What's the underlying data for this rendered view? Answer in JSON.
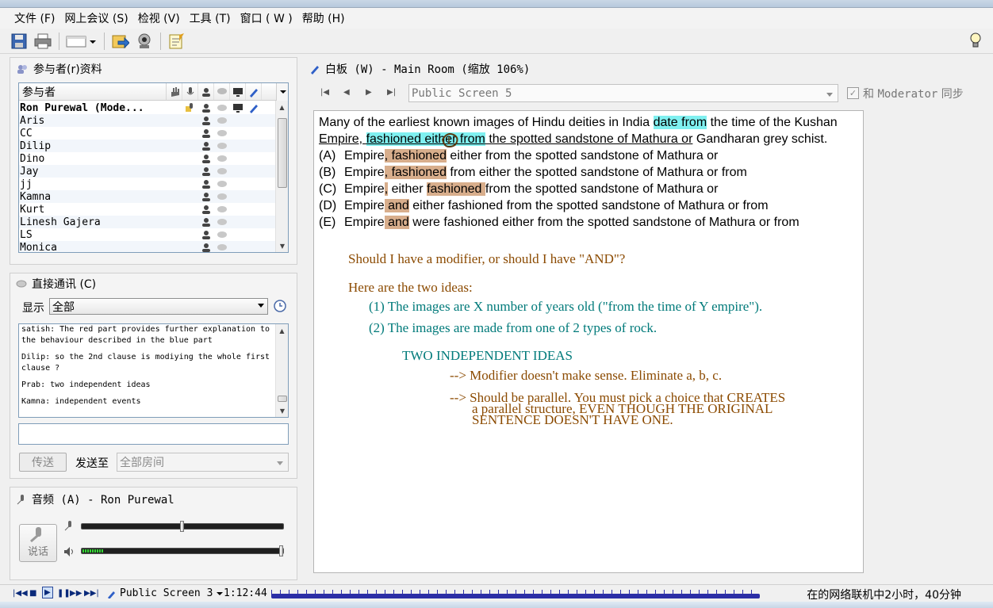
{
  "menu": [
    {
      "label": "文件 (F)"
    },
    {
      "label": "网上会议 (S)"
    },
    {
      "label": "检视 (V)"
    },
    {
      "label": "工具 (T)"
    },
    {
      "label": "窗口 ( W )"
    },
    {
      "label": "帮助 (H)"
    }
  ],
  "participants": {
    "title": "参与者(r)资料",
    "column_header": "参与者",
    "rows": [
      {
        "name": "Ron Purewal (Mode..."
      },
      {
        "name": "Aris"
      },
      {
        "name": "CC"
      },
      {
        "name": "Dilip"
      },
      {
        "name": "Dino"
      },
      {
        "name": "Jay"
      },
      {
        "name": "jj"
      },
      {
        "name": "Kamna"
      },
      {
        "name": "Kurt"
      },
      {
        "name": "Linesh Gajera"
      },
      {
        "name": "LS"
      },
      {
        "name": "Monica"
      }
    ]
  },
  "chat": {
    "title": "直接通讯 (C)",
    "filter_label": "显示",
    "filter_value": "全部",
    "messages": [
      {
        "text": "satish: The red part provides further explanation to the behaviour described in the blue part"
      },
      {
        "text": "Dilip: so the 2nd clause is modiying the whole first clause ?"
      },
      {
        "text": "Prab: two independent ideas"
      },
      {
        "text": "Kamna: independent events"
      }
    ],
    "send_label": "传送",
    "send_to_label": "发送至",
    "send_to_value": "全部房间"
  },
  "audio": {
    "title": "音频 (A) - Ron Purewal",
    "talk_label": "说话",
    "mic_level": 0.5,
    "speaker_level": 1.0
  },
  "whiteboard": {
    "title": "白板 (W) - Main Room (缩放 106%)",
    "screen_select": "Public Screen 5",
    "sync_label_prefix": "和",
    "sync_label_name": "Moderator",
    "sync_label_suffix": "同步",
    "question": {
      "s1": "Many of the earliest known images of Hindu deities in India ",
      "s2": "date from",
      "s3": " the time of the Kushan",
      "s4": "Empire, ",
      "s5": "fashioned either from",
      "s6": " the spotted sandstone of Mathura or",
      "s7": " Gandharan grey schist."
    },
    "choices": [
      {
        "label": "(A)",
        "pre": "Empire",
        "hl": ", fashioned",
        "post": " either from the spotted sandstone of Mathura or"
      },
      {
        "label": "(B)",
        "pre": "Empire",
        "hl": ", fashioned",
        "post": " from either the spotted sandstone of Mathura or from"
      },
      {
        "label": "(C)",
        "pre": "Empire",
        "hl": ",",
        "mid": " either ",
        "hl2": "fashioned ",
        "post": "from the spotted sandstone of Mathura or"
      },
      {
        "label": "(D)",
        "pre": "Empire",
        "hl": " and",
        "post": " either fashioned from the spotted sandstone of Mathura or from"
      },
      {
        "label": "(E)",
        "pre": "Empire",
        "hl": " and",
        "post": " were fashioned either from the spotted sandstone of Mathura or from"
      }
    ],
    "notes": {
      "n1": "Should I have a modifier, or should I have \"AND\"?",
      "n2": "Here are the two ideas:",
      "n3": "(1) The images are X number of years old (\"from the time of Y empire\").",
      "n4": "(2) The images are made from one of 2 types of rock.",
      "n5": "TWO INDEPENDENT IDEAS",
      "n6": "--> Modifier doesn't make sense.  Eliminate a, b, c.",
      "n7": "--> Should be parallel.  You must pick a choice that CREATES",
      "n8": "a parallel structure, EVEN THOUGH THE ORIGINAL",
      "n9": "SENTENCE DOESN'T HAVE ONE."
    }
  },
  "playback": {
    "screen": "Public Screen 3",
    "time": "1:12:44",
    "status": "在的网络联机中2小时，40分钟"
  },
  "colors": {
    "highlight_cyan": "#7ff0f0",
    "highlight_tan": "#d8ae8c",
    "note_brown": "#8b4a00",
    "note_teal": "#007a7a",
    "timeline": "#2b2ea6"
  }
}
